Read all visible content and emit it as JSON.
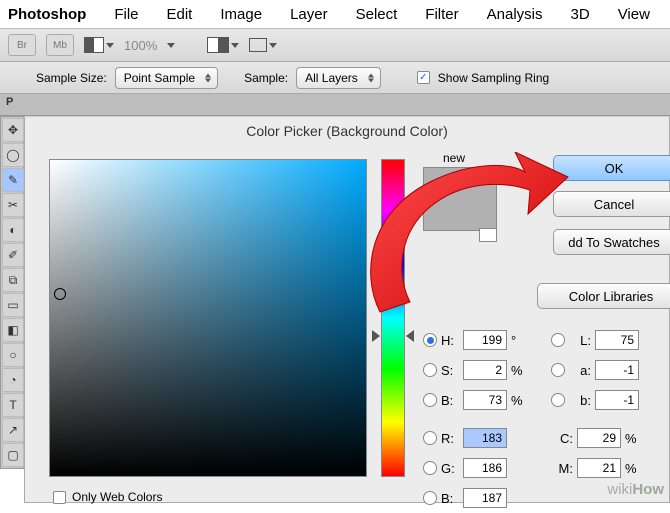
{
  "menubar": {
    "brand": "Photoshop",
    "items": [
      "File",
      "Edit",
      "Image",
      "Layer",
      "Select",
      "Filter",
      "Analysis",
      "3D",
      "View"
    ]
  },
  "optbar1": {
    "br": "Br",
    "mb": "Mb",
    "zoom": "100%"
  },
  "optbar2": {
    "sample_size_label": "Sample Size:",
    "sample_size_value": "Point Sample",
    "sample_label": "Sample:",
    "sample_value": "All Layers",
    "show_ring": "Show Sampling Ring",
    "checked": "✓"
  },
  "tabstrip": {
    "p": "P"
  },
  "dialog": {
    "title": "Color Picker (Background Color)",
    "new_label": "new",
    "ok": "OK",
    "cancel": "Cancel",
    "add": "dd To Swatches",
    "libraries": "Color Libraries",
    "only_web": "Only Web Colors",
    "fields": {
      "H": {
        "label": "H:",
        "value": "199",
        "unit": "°"
      },
      "S": {
        "label": "S:",
        "value": "2",
        "unit": "%"
      },
      "B": {
        "label": "B:",
        "value": "73",
        "unit": "%"
      },
      "R": {
        "label": "R:",
        "value": "183",
        "unit": ""
      },
      "G": {
        "label": "G:",
        "value": "186",
        "unit": ""
      },
      "Bc": {
        "label": "B:",
        "value": "187",
        "unit": ""
      },
      "L": {
        "label": "L:",
        "value": "75"
      },
      "a": {
        "label": "a:",
        "value": "-1"
      },
      "b": {
        "label": "b:",
        "value": "-1"
      },
      "C": {
        "label": "C:",
        "value": "29",
        "unit": "%"
      },
      "M": {
        "label": "M:",
        "value": "21",
        "unit": "%"
      }
    }
  },
  "watermark": {
    "wiki": "wiki",
    "how": "How"
  }
}
